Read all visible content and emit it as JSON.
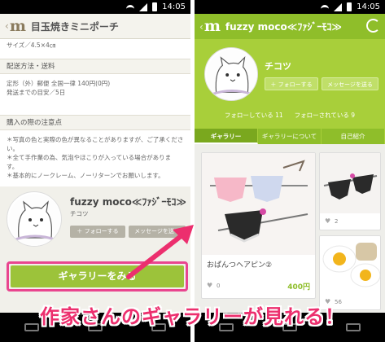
{
  "status": {
    "time": "14:05"
  },
  "left": {
    "header": {
      "logo": "m",
      "title": "目玉焼きミニポーチ"
    },
    "size_line": "サイズ／4.5×4㎝",
    "shipping_head": "配送方法・送料",
    "shipping_lines": [
      "定形（外）郵便 全国一律 140円(0円)",
      "発送までの目安／5日"
    ],
    "notes_head": "購入の際の注意点",
    "notes_lines": [
      "＊写真の色と実際の色が異なることがありますが、ご了承くださ",
      "い。",
      "＊全て手作業の為、気泡やほこりが入っている場合がありま",
      "す。",
      "＊基本的にノークレーム、ノーリターンでお願いします。"
    ],
    "creator": {
      "name": "fuzzy moco≪ﾌｧｼﾞｰﾓｺ≫",
      "handle": "チコツ",
      "follow": "＋ フォローする",
      "message": "メッセージを送る"
    },
    "gallery_button": "ギャラリーをみる"
  },
  "right": {
    "header": {
      "logo": "m",
      "title": "fuzzy moco≪ﾌｧｼﾞｰﾓｺ≫"
    },
    "profile_name": "チコツ",
    "follow": "＋ フォローする",
    "message": "メッセージを送る",
    "following": "フォローしている 11",
    "followers": "フォローされている 9",
    "tabs": [
      "ギャラリー",
      "ギャラリーについて",
      "自己紹介"
    ],
    "items": [
      {
        "title": "おぱんつヘアピン②",
        "price": "400円",
        "likes": "0"
      },
      {
        "title": "",
        "price": "",
        "likes": "2"
      },
      {
        "title": "",
        "price": "",
        "likes": "56"
      }
    ]
  },
  "banner": "作家さんのギャラリーが見れる！"
}
